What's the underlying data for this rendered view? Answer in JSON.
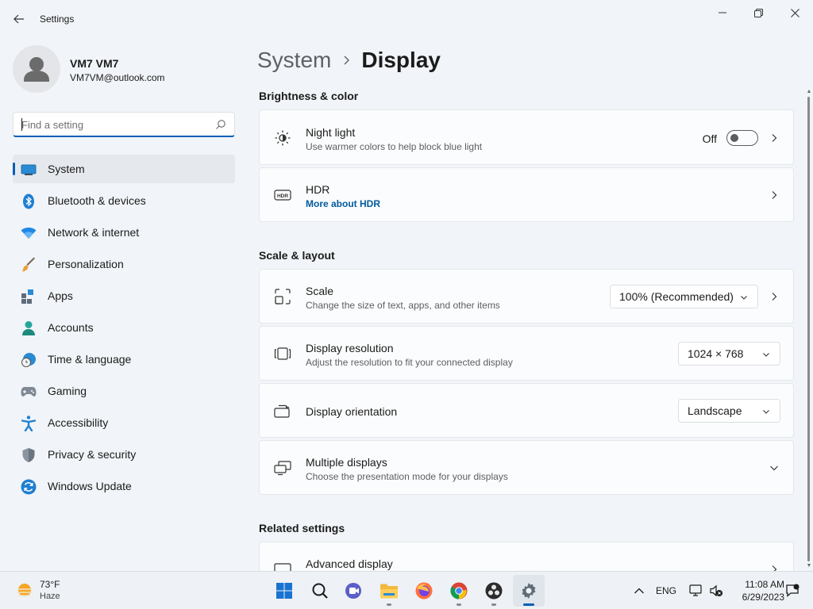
{
  "window": {
    "title": "Settings",
    "controls": {
      "minimize": "minimize",
      "maximize": "maximize",
      "close": "close"
    }
  },
  "user": {
    "name": "VM7 VM7",
    "email": "VM7VM@outlook.com"
  },
  "search": {
    "placeholder": "Find a setting",
    "value": ""
  },
  "sidebar": {
    "items": [
      {
        "label": "System",
        "icon": "monitor-icon",
        "active": true
      },
      {
        "label": "Bluetooth & devices",
        "icon": "bluetooth-icon"
      },
      {
        "label": "Network & internet",
        "icon": "wifi-icon"
      },
      {
        "label": "Personalization",
        "icon": "brush-icon"
      },
      {
        "label": "Apps",
        "icon": "apps-icon"
      },
      {
        "label": "Accounts",
        "icon": "person-icon"
      },
      {
        "label": "Time & language",
        "icon": "clock-globe-icon"
      },
      {
        "label": "Gaming",
        "icon": "gamepad-icon"
      },
      {
        "label": "Accessibility",
        "icon": "accessibility-icon"
      },
      {
        "label": "Privacy & security",
        "icon": "shield-icon"
      },
      {
        "label": "Windows Update",
        "icon": "update-icon"
      }
    ]
  },
  "breadcrumb": {
    "parent": "System",
    "current": "Display"
  },
  "sections": {
    "brightness": "Brightness & color",
    "scale_layout": "Scale & layout",
    "related": "Related settings"
  },
  "cards": {
    "night_light": {
      "title": "Night light",
      "subtitle": "Use warmer colors to help block blue light",
      "toggle_label": "Off",
      "toggle_on": false
    },
    "hdr": {
      "title": "HDR",
      "link": "More about HDR"
    },
    "scale": {
      "title": "Scale",
      "subtitle": "Change the size of text, apps, and other items",
      "value": "100% (Recommended)"
    },
    "resolution": {
      "title": "Display resolution",
      "subtitle": "Adjust the resolution to fit your connected display",
      "value": "1024 × 768"
    },
    "orientation": {
      "title": "Display orientation",
      "value": "Landscape"
    },
    "multiple": {
      "title": "Multiple displays",
      "subtitle": "Choose the presentation mode for your displays"
    },
    "advanced": {
      "title": "Advanced display"
    }
  },
  "taskbar": {
    "weather": {
      "temp": "73°F",
      "desc": "Haze"
    },
    "apps": [
      "start-icon",
      "search-icon",
      "meet-icon",
      "file-explorer-icon",
      "firefox-icon",
      "chrome-icon",
      "obs-icon",
      "settings-icon"
    ],
    "language": "ENG",
    "time": "11:08 AM",
    "date": "6/29/2023"
  },
  "colors": {
    "accent": "#005fb8",
    "link": "#005a9e",
    "background": "#f1f4f8",
    "card": "#fbfcfd"
  }
}
